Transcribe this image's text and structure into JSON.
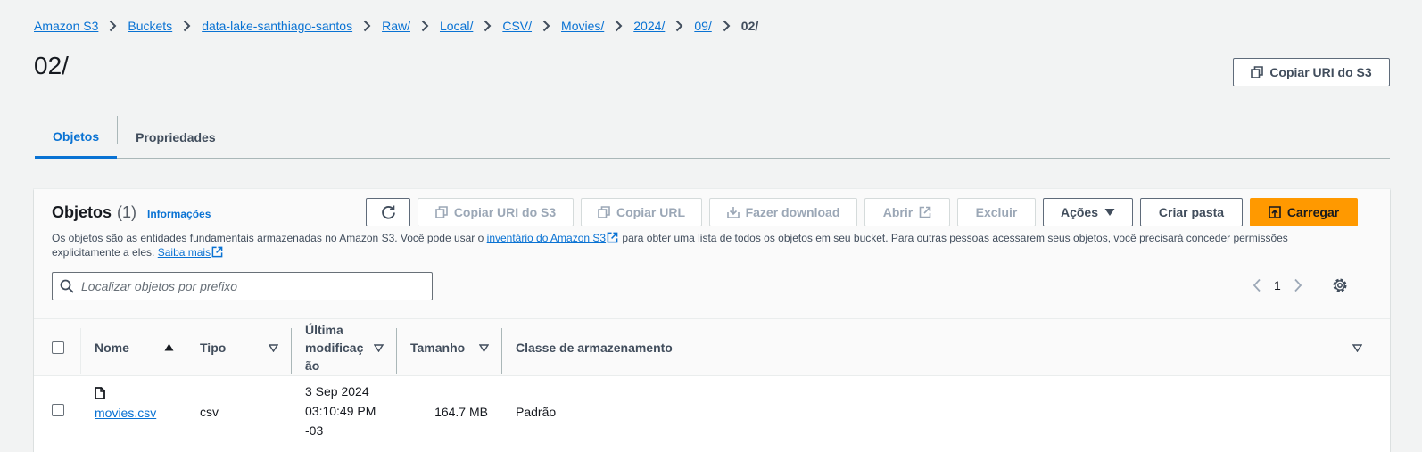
{
  "breadcrumb": [
    "Amazon S3",
    "Buckets",
    "data-lake-santhiago-santos",
    "Raw/",
    "Local/",
    "CSV/",
    "Movies/",
    "2024/",
    "09/",
    "02/"
  ],
  "page_title": "02/",
  "header_button": "Copiar URI do S3",
  "tabs": [
    "Objetos",
    "Propriedades"
  ],
  "panel": {
    "title": "Objetos",
    "count": "(1)",
    "info_link": "Informações",
    "toolbar": {
      "copy_uri": "Copiar URI do S3",
      "copy_url": "Copiar URL",
      "download": "Fazer download",
      "open": "Abrir",
      "delete": "Excluir",
      "actions": "Ações",
      "create_folder": "Criar pasta",
      "upload": "Carregar"
    },
    "description_part1": "Os objetos são as entidades fundamentais armazenadas no Amazon S3. Você pode usar o ",
    "description_link": "inventário do Amazon S3",
    "description_part2": " para obter uma lista de todos os objetos em seu bucket. Para outras pessoas acessarem seus objetos, você precisará conceder permissões explicitamente a eles. ",
    "learn_more": "Saiba mais",
    "search_placeholder": "Localizar objetos por prefixo",
    "page_number": "1"
  },
  "table": {
    "columns": {
      "name": "Nome",
      "type": "Tipo",
      "modified_line1": "Última",
      "modified_line2": "modificaç",
      "modified_line3": "ão",
      "size": "Tamanho",
      "storage": "Classe de armazenamento"
    },
    "rows": [
      {
        "name": "movies.csv",
        "type": "csv",
        "modified_line1": "3 Sep 2024",
        "modified_line2": "03:10:49 PM",
        "modified_line3": "-03",
        "size": "164.7 MB",
        "storage": "Padrão"
      }
    ]
  },
  "colors": {
    "link": "#0972d3",
    "primary": "#ff9900",
    "background": "#f2f3f3"
  }
}
